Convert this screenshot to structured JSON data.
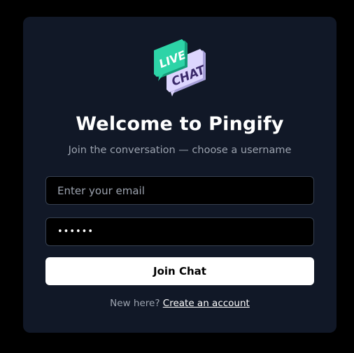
{
  "app": {
    "logo": {
      "icon": "live-chat-logo-icon",
      "top_text": "LIVE",
      "bottom_text": "CHAT",
      "colors": {
        "green": "#2dd4a7",
        "green_dark": "#169c7a",
        "lavender": "#ddd6fe",
        "lavender_dark": "#a7a0d8",
        "text_dark": "#3b2a6b"
      }
    },
    "title": "Welcome to Pingify",
    "subtitle": "Join the conversation — choose a username"
  },
  "form": {
    "email": {
      "placeholder": "Enter your email",
      "value": ""
    },
    "password": {
      "value": "••••••"
    },
    "submit_label": "Join Chat"
  },
  "footer": {
    "prompt": "New here?",
    "link_label": "Create an account"
  },
  "colors": {
    "page_background": "#000000",
    "card_background": "#111827",
    "input_border": "#374151",
    "muted_text": "#9ca3af",
    "button_background": "#ffffff"
  }
}
